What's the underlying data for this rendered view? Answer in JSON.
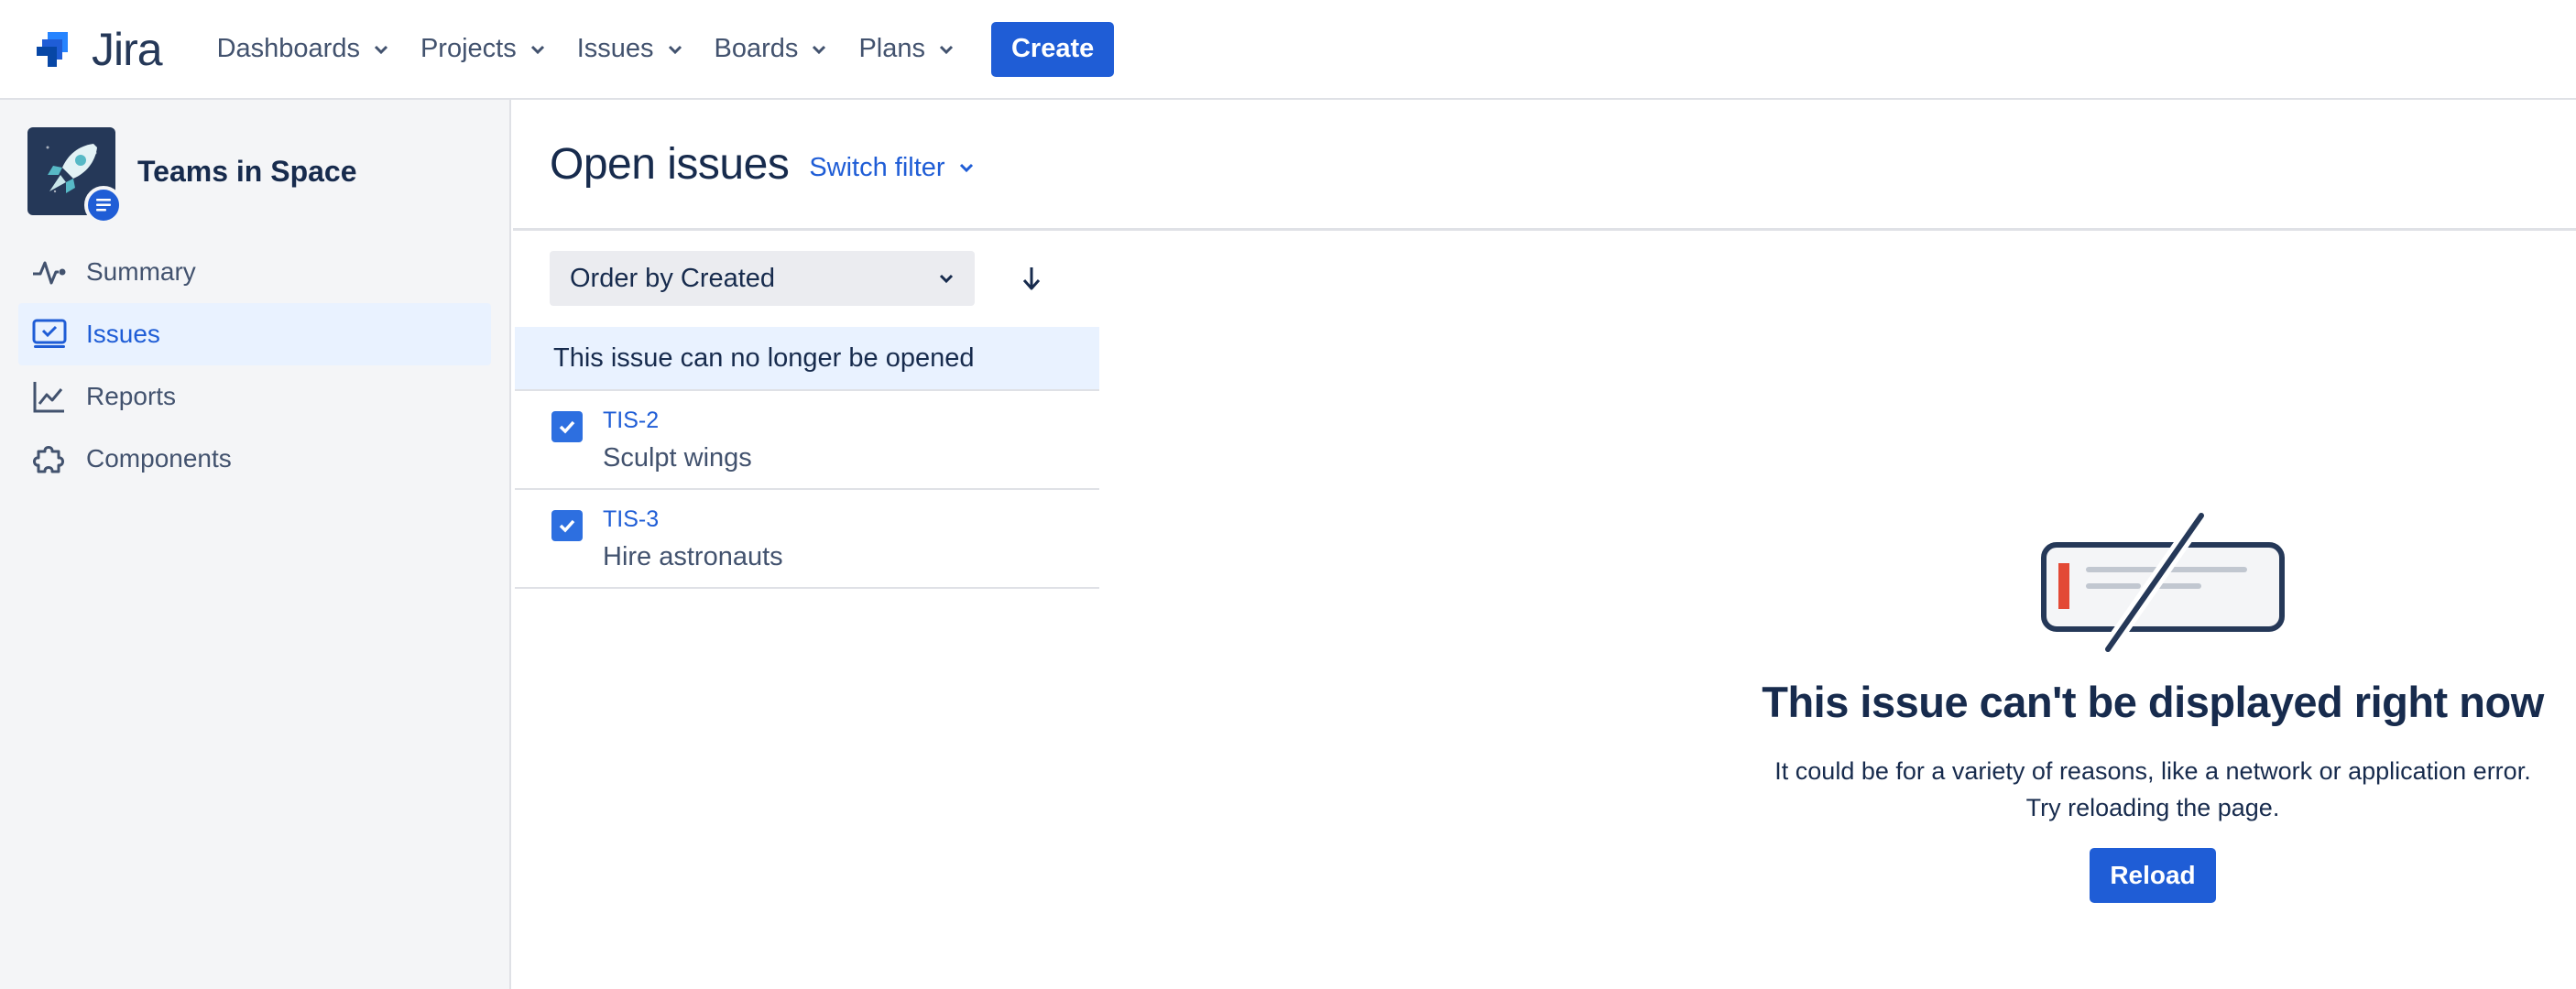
{
  "app": {
    "name": "Jira"
  },
  "topnav": {
    "items": [
      {
        "label": "Dashboards"
      },
      {
        "label": "Projects"
      },
      {
        "label": "Issues"
      },
      {
        "label": "Boards"
      },
      {
        "label": "Plans"
      }
    ],
    "create_label": "Create"
  },
  "sidebar": {
    "project_name": "Teams in Space",
    "items": [
      {
        "label": "Summary",
        "icon": "activity-icon",
        "active": false
      },
      {
        "label": "Issues",
        "icon": "issues-icon",
        "active": true
      },
      {
        "label": "Reports",
        "icon": "reports-icon",
        "active": false
      },
      {
        "label": "Components",
        "icon": "puzzle-icon",
        "active": false
      }
    ]
  },
  "main": {
    "title": "Open issues",
    "switch_filter_label": "Switch filter",
    "order_label": "Order by Created",
    "banner": "This issue can no longer be opened",
    "issues": [
      {
        "key": "TIS-2",
        "summary": "Sculpt wings"
      },
      {
        "key": "TIS-3",
        "summary": "Hire astronauts"
      }
    ]
  },
  "error": {
    "title": "This issue can't be displayed right now",
    "line1": "It could be for a variety of reasons, like a network or application error.",
    "line2": "Try reloading the page.",
    "reload_label": "Reload"
  },
  "colors": {
    "brand": "#1f5dd6",
    "active_bg": "#e9f2ff",
    "sidebar_bg": "#f4f5f7",
    "text": "#172b4d"
  }
}
